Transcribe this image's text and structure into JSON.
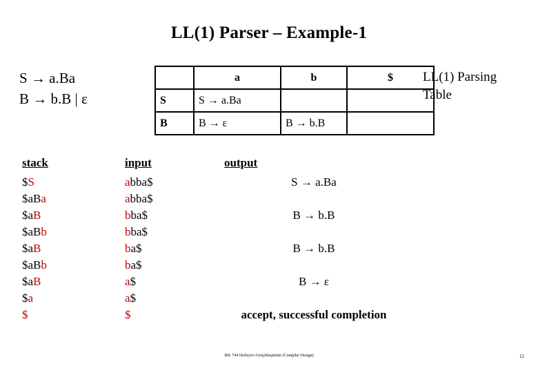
{
  "slide": {
    "title": "LL(1) Parser – Example-1",
    "grammar": [
      "S → a.Ba",
      "B → b.B  | ε"
    ],
    "table_label": "LL(1) Parsing Table",
    "footer": "BIL 744 Derleyici Gerçekleştirimi (Compiler Design)",
    "page_number": "12"
  },
  "parsing_table": {
    "columns": [
      "",
      "a",
      "b",
      "$"
    ],
    "rows": [
      {
        "head": "S",
        "cells": [
          "S → a.Ba",
          "",
          ""
        ]
      },
      {
        "head": "B",
        "cells": [
          "B → ε",
          "B → b.B",
          ""
        ]
      }
    ]
  },
  "trace": {
    "headers": {
      "stack": "stack",
      "input": "input",
      "output": "output"
    },
    "rows": [
      {
        "stack_black": "$",
        "stack_red": "S",
        "input_red": "a",
        "input_black": "bba$",
        "output": "S → a.Ba"
      },
      {
        "stack_black": "$aB",
        "stack_red": "a",
        "input_red": "a",
        "input_black": "bba$",
        "output": ""
      },
      {
        "stack_black": "$a",
        "stack_red": "B",
        "input_red": "b",
        "input_black": "ba$",
        "output": "B → b.B"
      },
      {
        "stack_black": "$aB",
        "stack_red": "b",
        "input_red": "b",
        "input_black": "ba$",
        "output": ""
      },
      {
        "stack_black": "$a",
        "stack_red": "B",
        "input_red": "b",
        "input_black": "a$",
        "output": "B → b.B"
      },
      {
        "stack_black": "$aB",
        "stack_red": "b",
        "input_red": "b",
        "input_black": "a$",
        "output": ""
      },
      {
        "stack_black": "$a",
        "stack_red": "B",
        "input_red": "a",
        "input_black": "$",
        "output": "B → ε"
      },
      {
        "stack_black": "$",
        "stack_red": "a",
        "input_red": "a",
        "input_black": "$",
        "output": ""
      },
      {
        "stack_black": "",
        "stack_red": "$",
        "input_red": "$",
        "input_black": "",
        "output": "accept, successful completion"
      }
    ],
    "accept_row_index": 8
  },
  "colors": {
    "highlight": "#c00000",
    "text": "#000000",
    "background": "#ffffff"
  }
}
